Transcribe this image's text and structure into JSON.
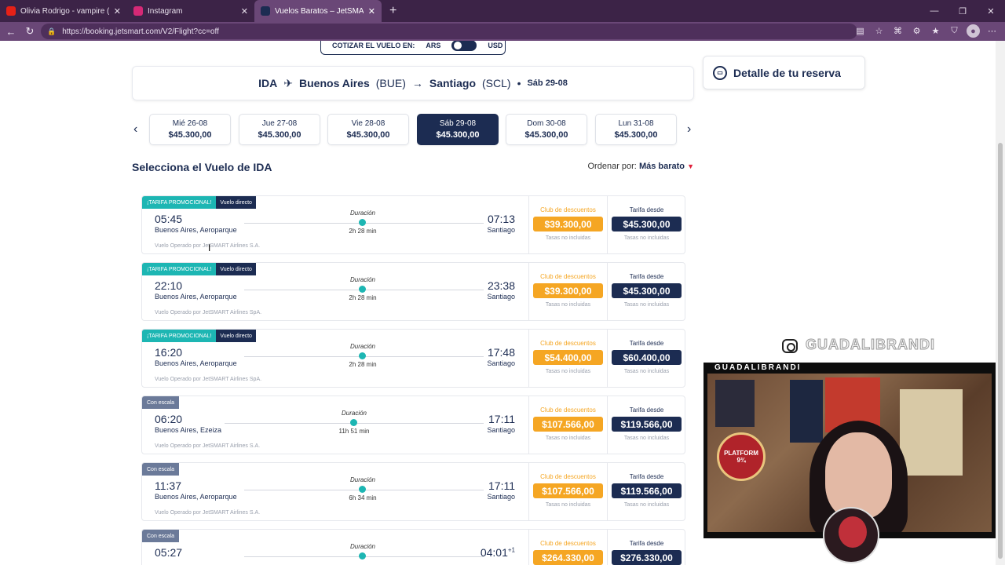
{
  "browser": {
    "tabs": [
      {
        "title": "Olivia Rodrigo - vampire (Offi",
        "icon": "youtube-icon",
        "color": "#e62117",
        "active": false
      },
      {
        "title": "Instagram",
        "icon": "instagram-icon",
        "color": "#d62976",
        "active": false
      },
      {
        "title": "Vuelos Baratos – JetSMART Aviones",
        "icon": "jetsmart-icon",
        "color": "#1c2c52",
        "active": true
      }
    ],
    "url": "https://booking.jetsmart.com/V2/Flight?cc=off"
  },
  "currency": {
    "label": "COTIZAR EL VUELO EN:",
    "left": "ARS",
    "right": "USD"
  },
  "route": {
    "direction": "IDA",
    "origin": "Buenos Aires",
    "origin_code": "(BUE)",
    "destination": "Santiago",
    "dest_code": "(SCL)",
    "date": "Sáb 29-08"
  },
  "detalle": "Detalle de tu reserva",
  "dates": [
    {
      "day": "Mié 26-08",
      "price": "$45.300,00"
    },
    {
      "day": "Jue 27-08",
      "price": "$45.300,00"
    },
    {
      "day": "Vie 28-08",
      "price": "$45.300,00"
    },
    {
      "day": "Sáb 29-08",
      "price": "$45.300,00",
      "selected": true
    },
    {
      "day": "Dom 30-08",
      "price": "$45.300,00"
    },
    {
      "day": "Lun 31-08",
      "price": "$45.300,00"
    }
  ],
  "section_title": "Selecciona el Vuelo de IDA",
  "sort": {
    "label": "Ordenar por:",
    "value": "Más barato"
  },
  "labels": {
    "promo": "¡TARIFA PROMOCIONAL!",
    "direct": "Vuelo directo",
    "escala": "Con escala",
    "duracion": "Duración",
    "club": "Club de descuentos",
    "tarifa": "Tarifa desde",
    "tasas": "Tasas no incluidas"
  },
  "flights": [
    {
      "dep": "05:45",
      "dep_place": "Buenos Aires, Aeroparque",
      "arr": "07:13",
      "arr_place": "Santiago",
      "duration": "2h 28 min",
      "operator": "Vuelo Operado por JetSMART Airlines S.A.",
      "club_price": "$39.300,00",
      "price": "$45.300,00",
      "promo": true
    },
    {
      "dep": "22:10",
      "dep_place": "Buenos Aires, Aeroparque",
      "arr": "23:38",
      "arr_place": "Santiago",
      "duration": "2h 28 min",
      "operator": "Vuelo Operado por JetSMART Airlines SpA.",
      "club_price": "$39.300,00",
      "price": "$45.300,00",
      "promo": true
    },
    {
      "dep": "16:20",
      "dep_place": "Buenos Aires, Aeroparque",
      "arr": "17:48",
      "arr_place": "Santiago",
      "duration": "2h 28 min",
      "operator": "Vuelo Operado por JetSMART Airlines SpA.",
      "club_price": "$54.400,00",
      "price": "$60.400,00",
      "promo": true
    },
    {
      "dep": "06:20",
      "dep_place": "Buenos Aires, Ezeiza",
      "arr": "17:11",
      "arr_place": "Santiago",
      "duration": "11h 51 min",
      "operator": "Vuelo Operado por JetSMART Airlines S.A.",
      "club_price": "$107.566,00",
      "price": "$119.566,00",
      "promo": false
    },
    {
      "dep": "11:37",
      "dep_place": "Buenos Aires, Aeroparque",
      "arr": "17:11",
      "arr_place": "Santiago",
      "duration": "6h 34 min",
      "operator": "Vuelo Operado por JetSMART Airlines S.A.",
      "club_price": "$107.566,00",
      "price": "$119.566,00",
      "promo": false
    },
    {
      "dep": "05:27",
      "dep_place": "",
      "arr": "04:01",
      "arr_sup": "+1",
      "arr_place": "",
      "duration": "",
      "operator": "",
      "club_price": "$264.330,00",
      "price": "$276.330,00",
      "promo": false
    }
  ],
  "stream": {
    "handle": "GUADALIBRANDI",
    "label": "GUADALIBRANDI",
    "platform_sign": "PLATFORM 9¾"
  }
}
